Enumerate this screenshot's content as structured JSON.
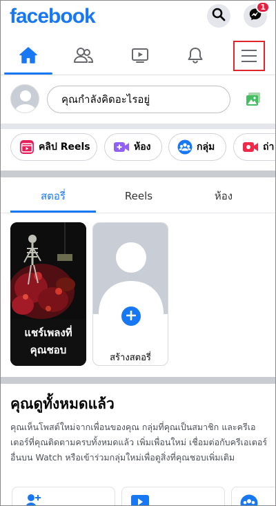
{
  "header": {
    "logo": "facebook",
    "messenger_badge": "1"
  },
  "nav": {
    "tabs": [
      "home",
      "friends",
      "watch",
      "notifications",
      "menu"
    ],
    "active": "home"
  },
  "composer": {
    "placeholder": "คุณกำลังคิดอะไรอยู่"
  },
  "chips": [
    {
      "label": "คลิป Reels",
      "icon": "reels-icon"
    },
    {
      "label": "ห้อง",
      "icon": "rooms-video-icon"
    },
    {
      "label": "กลุ่ม",
      "icon": "groups-icon"
    },
    {
      "label": "ถ่า",
      "icon": "live-video-icon"
    }
  ],
  "story_tabs": [
    {
      "label": "สตอรี่",
      "active": true
    },
    {
      "label": "Reels",
      "active": false
    },
    {
      "label": "ห้อง",
      "active": false
    }
  ],
  "stories": {
    "reel_caption_line1": "แชร์เพลงที่",
    "reel_caption_line2": "คุณชอบ",
    "create_label": "สร้างสตอรี่"
  },
  "caught_up": {
    "title": "คุณดูทั้งหมดแล้ว",
    "body": "คุณเห็นโพสต์ใหม่จากเพื่อนของคุณ กลุ่มที่คุณเป็นสมาชิก และครีเอเตอร์ที่คุณติดตามครบทั้งหมดแล้ว เพิ่มเพื่อนใหม่ เชื่อมต่อกับครีเอเตอร์อื่นบน Watch หรือเข้าร่วมกลุ่มใหม่เพื่อดูสิ่งที่คุณชอบเพิ่มเติม"
  },
  "colors": {
    "brand": "#1877f2",
    "badge": "#e41e3f",
    "highlight": "#e0242a"
  }
}
